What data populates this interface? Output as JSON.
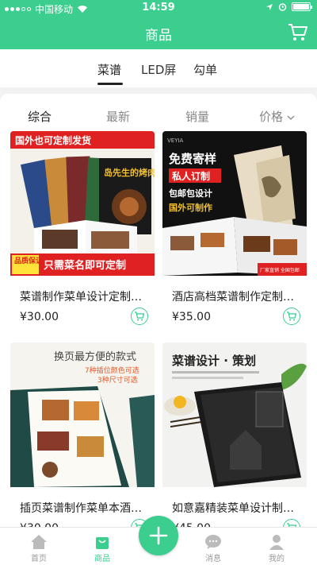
{
  "status_bar": {
    "carrier": "中国移动",
    "time": "14:59"
  },
  "header": {
    "title": "商品",
    "cart_icon": "cart-icon"
  },
  "tabs": [
    {
      "label": "菜谱",
      "active": true
    },
    {
      "label": "LED屏",
      "active": false
    },
    {
      "label": "勾单",
      "active": false
    }
  ],
  "sort": [
    {
      "label": "综合",
      "active": true
    },
    {
      "label": "最新",
      "active": false
    },
    {
      "label": "销量",
      "active": false
    },
    {
      "label": "价格",
      "active": false
    }
  ],
  "products": [
    {
      "name": "菜谱制作菜单设计定制…",
      "price": "¥30.00",
      "image_text": {
        "top_banner": "国外也可定制发货",
        "book_title": "岛先生的烤肉店",
        "badge": "品质保证",
        "bottom_banner": "只需菜名即可定制"
      }
    },
    {
      "name": "酒店高档菜谱制作定制…",
      "price": "¥35.00",
      "image_text": {
        "brand": "VEYIA",
        "line1": "免费寄样",
        "line2": "私人订制",
        "line3": "包邮包设计",
        "line4": "国外可制作",
        "corner": "厂家直销  全国包邮"
      }
    },
    {
      "name": "插页菜谱制作菜单本酒…",
      "price": "¥30.00",
      "image_text": {
        "headline": "换页最方便的款式",
        "line1": "7种插位颜色可选",
        "line2": "3种尺寸可选"
      }
    },
    {
      "name": "如意嘉精装菜单设计制…",
      "price": "¥45.00",
      "image_text": {
        "headline": "菜谱设计 · 策划"
      }
    }
  ],
  "bottom_nav": [
    {
      "label": "首页",
      "icon": "home-icon"
    },
    {
      "label": "商品",
      "icon": "bag-icon",
      "active": true
    },
    {
      "label": "",
      "icon": "plus-icon"
    },
    {
      "label": "消息",
      "icon": "message-icon"
    },
    {
      "label": "我的",
      "icon": "user-icon"
    }
  ],
  "colors": {
    "brand": "#3bce8e",
    "red": "#e02121"
  }
}
